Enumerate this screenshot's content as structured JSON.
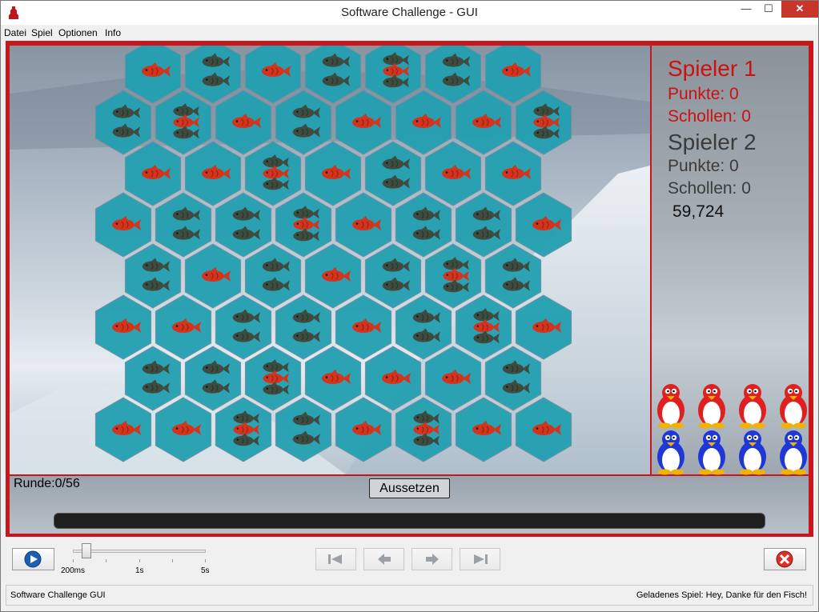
{
  "window": {
    "title": "Software Challenge - GUI"
  },
  "menu": [
    "Datei",
    "Spiel",
    "Optionen",
    "Info"
  ],
  "players": [
    {
      "name": "Spieler 1",
      "points_label": "Punkte: 0",
      "floes_label": "Schollen: 0",
      "color": "#cc1111"
    },
    {
      "name": "Spieler 2",
      "points_label": "Punkte: 0",
      "floes_label": "Schollen: 0",
      "color": "#3b3b3b"
    }
  ],
  "timer": "59,724",
  "board": {
    "rows": [
      [
        1,
        2,
        1,
        2,
        3,
        2,
        1
      ],
      [
        2,
        3,
        1,
        2,
        1,
        1,
        1,
        3
      ],
      [
        1,
        1,
        3,
        1,
        2,
        1,
        1
      ],
      [
        1,
        2,
        2,
        3,
        1,
        2,
        2,
        1
      ],
      [
        2,
        1,
        2,
        1,
        2,
        3,
        2
      ],
      [
        1,
        1,
        2,
        2,
        1,
        2,
        3,
        1
      ],
      [
        2,
        2,
        3,
        1,
        1,
        1,
        2
      ],
      [
        1,
        1,
        3,
        2,
        1,
        3,
        1,
        1
      ]
    ],
    "legend": {
      "1": "one red fish",
      "2": "two dark fish",
      "3": "three fish"
    },
    "colors": {
      "tile": "#22a0b1",
      "red_fish": "#d4341d",
      "dark_fish": "#3e4b3f"
    }
  },
  "penguins": {
    "red_count": 4,
    "blue_count": 4,
    "red_color": "#e02020",
    "blue_color": "#1f37d6"
  },
  "round_label": "Runde:0/56",
  "pass_button": "Aussetzen",
  "progress": 0,
  "speed": {
    "labels": [
      "200ms",
      "1s",
      "5s"
    ]
  },
  "status": {
    "left": "Software Challenge GUI",
    "right": "Geladenes Spiel: Hey, Danke für den Fisch!"
  },
  "accents": {
    "frame": "#c8161a",
    "close": "#c7352b"
  }
}
